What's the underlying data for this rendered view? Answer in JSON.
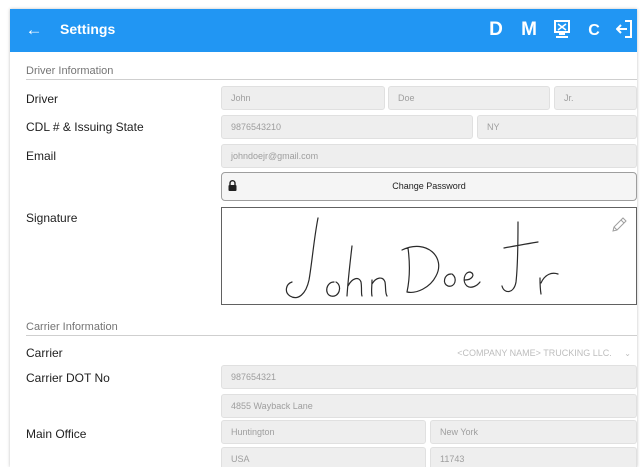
{
  "header": {
    "back_icon": "arrow-left-icon",
    "title": "Settings",
    "actions": [
      {
        "name": "d-button",
        "label": "D"
      },
      {
        "name": "m-button",
        "label": "M"
      },
      {
        "name": "device-icon",
        "label": ""
      },
      {
        "name": "refresh-icon",
        "label": "C"
      },
      {
        "name": "logout-icon",
        "label": ""
      }
    ],
    "background_color": "#2196f3"
  },
  "driver_info": {
    "section_title": "Driver Information",
    "driver": {
      "label": "Driver",
      "first_name": "John",
      "last_name": "Doe",
      "suffix": "Jr."
    },
    "cdl": {
      "label": "CDL # & Issuing State",
      "number": "9876543210",
      "state": "NY"
    },
    "email": {
      "label": "Email",
      "value": "johndoejr@gmail.com"
    },
    "change_password_label": "Change Password",
    "signature": {
      "label": "Signature",
      "edit_icon": "pencil-icon"
    }
  },
  "carrier_info": {
    "section_title": "Carrier Information",
    "carrier": {
      "label": "Carrier",
      "value": "<COMPANY NAME> TRUCKING LLC."
    },
    "dot": {
      "label": "Carrier DOT No",
      "value": "987654321"
    },
    "main_office": {
      "label": "Main Office",
      "address": "4855 Wayback Lane",
      "city": "Huntington",
      "state": "New York",
      "country": "USA",
      "zip": "11743"
    }
  }
}
